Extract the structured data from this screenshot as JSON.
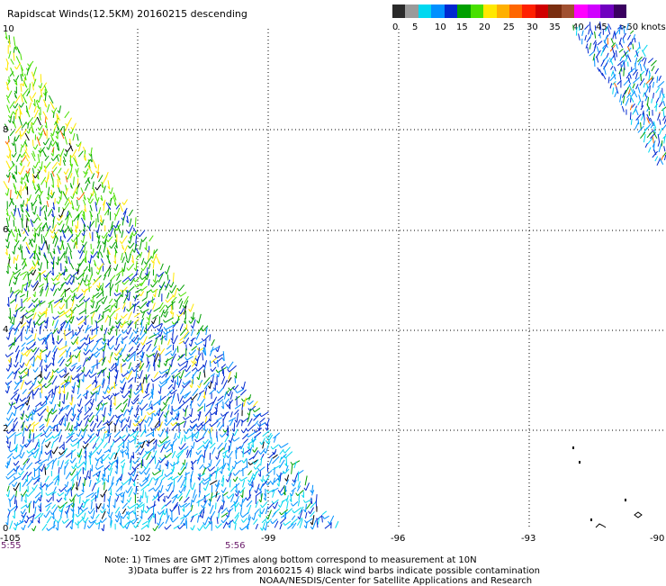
{
  "title": "Rapidscat Winds(12.5KM) 20160215 descending",
  "legend": {
    "ticks": [
      "0",
      "5",
      "10",
      "15",
      "20",
      "25",
      "30",
      "35",
      "40",
      "45",
      ">50 knots"
    ],
    "colors": [
      "#2a2a2a",
      "#9a9a9a",
      "#00d8f0",
      "#0090ff",
      "#0028d0",
      "#00a000",
      "#48e000",
      "#ffe800",
      "#ffb000",
      "#ff6600",
      "#ff2000",
      "#d00000",
      "#7a2e10",
      "#a05030",
      "#ff00ff",
      "#d000ff",
      "#7000c0",
      "#3a0060"
    ]
  },
  "axes": {
    "lat_labels": [
      "10",
      "8",
      "6",
      "4",
      "2",
      "0"
    ],
    "lon_labels": [
      "-105",
      "-102",
      "-99",
      "-96",
      "-93",
      "-90"
    ]
  },
  "times": {
    "left": "5:55",
    "right": "5:56"
  },
  "notes": {
    "line1": "Note: 1) Times are GMT 2)Times along bottom correspond to measurement at 10N",
    "line2": "3)Data buffer is 22 hrs from 20160215 4) Black wind barbs indicate possible contamination",
    "line3": "NOAA/NESDIS/Center for Satellite Applications and Research"
  }
}
